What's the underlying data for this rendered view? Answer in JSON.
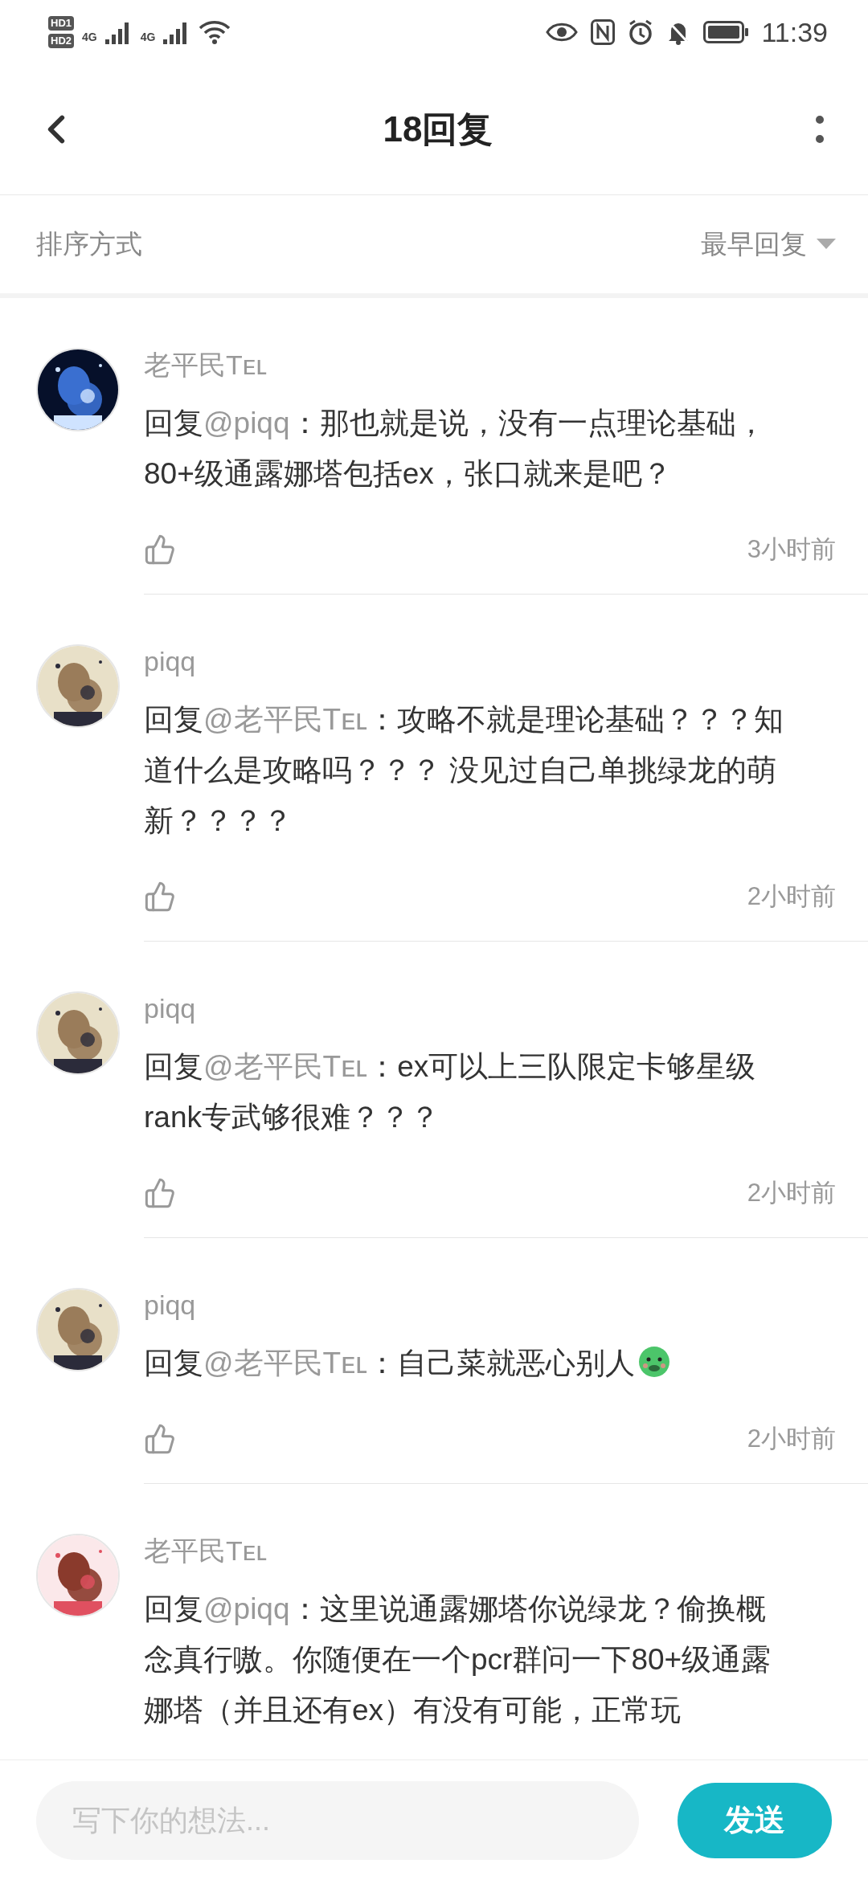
{
  "status_bar": {
    "sim_badges": [
      "HD1",
      "HD2"
    ],
    "network_labels": [
      "4G",
      "4G"
    ],
    "time": "11:39"
  },
  "header": {
    "title": "18回复"
  },
  "sort_bar": {
    "label": "排序方式",
    "value": "最早回复"
  },
  "comments": [
    {
      "author": "老平民Tᴇʟ",
      "reply_prefix": "回复",
      "mention": "@piqq",
      "text": "：那也就是说，没有一点理论基础，80+级通露娜塔包括ex，张口就来是吧？",
      "trailing_emoji": false,
      "time": "3小时前"
    },
    {
      "author": "piqq",
      "reply_prefix": "回复",
      "mention": "@老平民Tᴇʟ",
      "text": "：攻略不就是理论基础？？？知道什么是攻略吗？？？ 没见过自己单挑绿龙的萌新？？？？",
      "trailing_emoji": false,
      "time": "2小时前"
    },
    {
      "author": "piqq",
      "reply_prefix": "回复",
      "mention": "@老平民Tᴇʟ",
      "text": "：ex可以上三队限定卡够星级rank专武够很难？？？",
      "trailing_emoji": false,
      "time": "2小时前"
    },
    {
      "author": "piqq",
      "reply_prefix": "回复",
      "mention": "@老平民Tᴇʟ",
      "text": "：自己菜就恶心别人",
      "trailing_emoji": true,
      "time": "2小时前"
    },
    {
      "author": "老平民Tᴇʟ",
      "reply_prefix": "回复",
      "mention": "@piqq",
      "text": "：这里说通露娜塔你说绿龙？偷换概念真行嗷。你随便在一个pcr群问一下80+级通露娜塔（并且还有ex）有没有可能，正常玩",
      "trailing_emoji": false
    }
  ],
  "composer": {
    "placeholder": "写下你的想法...",
    "send_label": "发送"
  }
}
